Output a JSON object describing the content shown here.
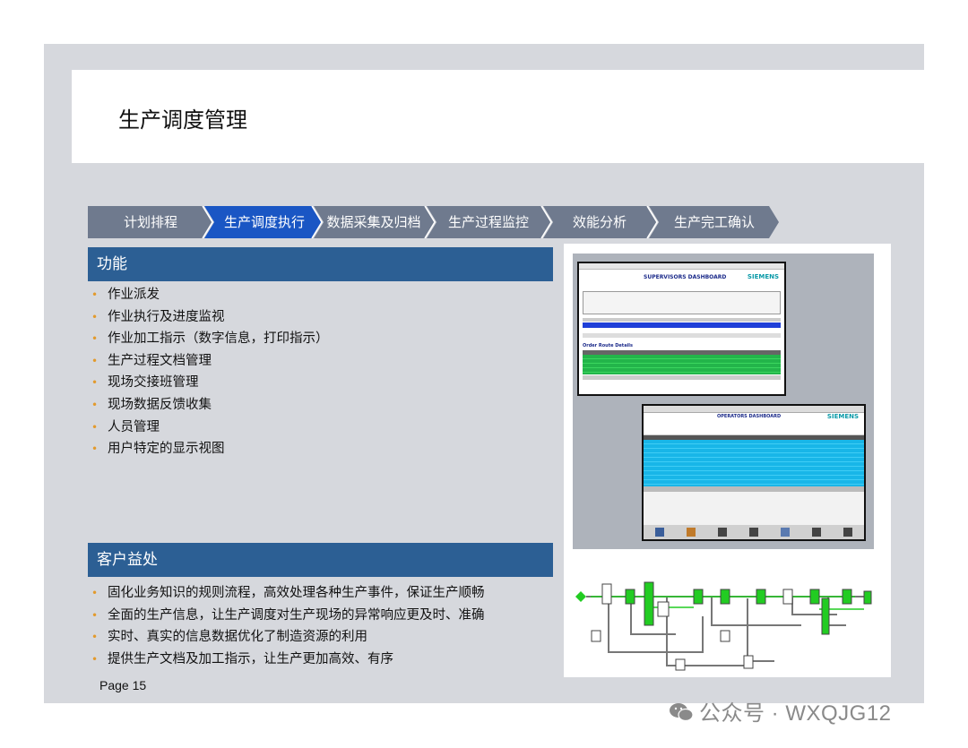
{
  "slide": {
    "title": "生产调度管理",
    "steps": [
      {
        "label": "计划排程",
        "active": false
      },
      {
        "label": "生产调度执行",
        "active": true
      },
      {
        "label": "数据采集及归档",
        "active": false
      },
      {
        "label": "生产过程监控",
        "active": false
      },
      {
        "label": "效能分析",
        "active": false
      },
      {
        "label": "生产完工确认",
        "active": false
      }
    ],
    "functions": {
      "heading": "功能",
      "items": [
        "作业派发",
        "作业执行及进度监视",
        "作业加工指示（数字信息，打印指示）",
        "生产过程文档管理",
        "现场交接班管理",
        "现场数据反馈收集",
        "人员管理",
        "用户特定的显示视图"
      ]
    },
    "benefits": {
      "heading": "客户益处",
      "items": [
        "固化业务知识的规则流程，高效处理各种生产事件，保证生产顺畅",
        "全面的生产信息，让生产调度对生产现场的异常响应更及时、准确",
        "实时、真实的信息数据优化了制造资源的利用",
        "提供生产文档及加工指示，让生产更加高效、有序"
      ]
    },
    "screenshot1": {
      "title": "SUPERVISORS DASHBOARD",
      "brand": "SIEMENS",
      "tab": "Order Route Details"
    },
    "screenshot2": {
      "title": "OPERATORS DASHBOARD",
      "brand": "SIEMENS"
    },
    "page": "Page 15",
    "colors": {
      "slide_bg": "#d6d8dd",
      "step_inactive": "#6f7a8e",
      "step_active": "#1a56c4",
      "section": "#2c5f94",
      "bullet": "#e39a2c"
    }
  },
  "watermark": "公众号 · WXQJG12"
}
